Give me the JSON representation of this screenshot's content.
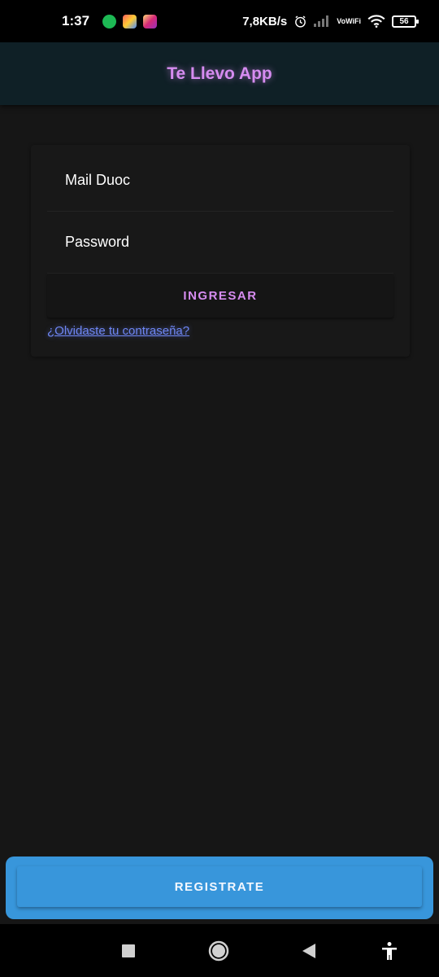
{
  "status_bar": {
    "time": "1:37",
    "network_speed": "7,8KB/s",
    "vowifi_top": "Vo",
    "vowifi_bottom": "WiFi",
    "battery": "56",
    "icons": [
      "spotify-icon",
      "photos-icon",
      "instagram-icon",
      "alarm-icon",
      "signal-icon",
      "vowifi-icon",
      "wifi-icon",
      "battery-icon"
    ]
  },
  "toolbar": {
    "title": "Te Llevo App"
  },
  "login": {
    "email_placeholder": "Mail Duoc",
    "password_placeholder": "Password",
    "submit_label": "INGRESAR",
    "forgot_label": "¿Olvidaste tu contraseña?"
  },
  "footer": {
    "register_label": "REGISTRATE"
  },
  "nav_bar": {
    "icons": [
      "recents-icon",
      "home-icon",
      "back-icon",
      "accessibility-icon"
    ]
  },
  "colors": {
    "background": "#161616",
    "toolbar": "#0f2026",
    "accent": "#d68cf0",
    "link": "#6e86f3",
    "register": "#3896db"
  }
}
